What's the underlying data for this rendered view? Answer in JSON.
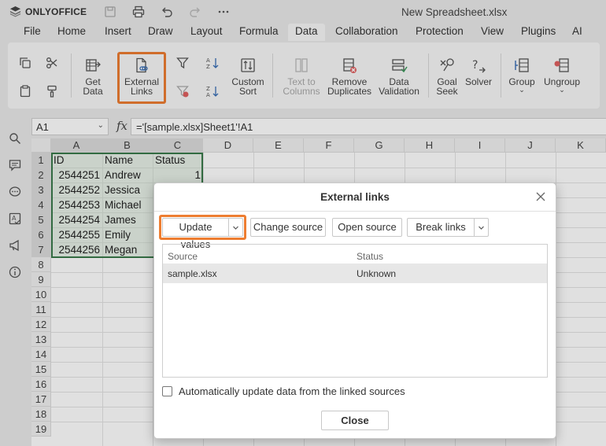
{
  "app": {
    "brand": "ONLYOFFICE",
    "document_title": "New Spreadsheet.xlsx"
  },
  "menu_tabs": [
    "File",
    "Home",
    "Insert",
    "Draw",
    "Layout",
    "Formula",
    "Data",
    "Collaboration",
    "Protection",
    "View",
    "Plugins",
    "AI"
  ],
  "active_tab": "Data",
  "toolbar": {
    "get_data": [
      "Get",
      "Data"
    ],
    "external_links": [
      "External",
      "Links"
    ],
    "custom_sort": [
      "Custom",
      "Sort"
    ],
    "text_to_columns": [
      "Text to",
      "Columns"
    ],
    "remove_duplicates": [
      "Remove",
      "Duplicates"
    ],
    "data_validation": [
      "Data",
      "Validation"
    ],
    "goal_seek": [
      "Goal",
      "Seek"
    ],
    "solver": "Solver",
    "group": "Group",
    "ungroup": "Ungroup",
    "highlight_color": "#ed7d31"
  },
  "formula_bar": {
    "name_box": "A1",
    "fx": "fx",
    "formula": "='[sample.xlsx]Sheet1'!A1"
  },
  "grid": {
    "columns": [
      "A",
      "B",
      "C",
      "D",
      "E",
      "F",
      "G",
      "H",
      "I",
      "J",
      "K"
    ],
    "rows": [
      "1",
      "2",
      "3",
      "4",
      "5",
      "6",
      "7",
      "8",
      "9",
      "10",
      "11",
      "12",
      "13",
      "14",
      "15",
      "16",
      "17",
      "18",
      "19"
    ],
    "data": [
      [
        "ID",
        "Name",
        "Status"
      ],
      [
        "2544251",
        "Andrew",
        "1"
      ],
      [
        "2544252",
        "Jessica",
        ""
      ],
      [
        "2544253",
        "Michael",
        ""
      ],
      [
        "2544254",
        "James",
        ""
      ],
      [
        "2544255",
        "Emily",
        ""
      ],
      [
        "2544256",
        "Megan",
        ""
      ]
    ],
    "selection_color": "#3a7a4a"
  },
  "dialog": {
    "title": "External links",
    "buttons": {
      "update_values": "Update values",
      "change_source": "Change source",
      "open_source": "Open source",
      "break_links": "Break links"
    },
    "table_headers": {
      "source": "Source",
      "status": "Status"
    },
    "rows": [
      {
        "source": "sample.xlsx",
        "status": "Unknown"
      }
    ],
    "auto_update_label": "Automatically update data from the linked sources",
    "close_label": "Close"
  }
}
